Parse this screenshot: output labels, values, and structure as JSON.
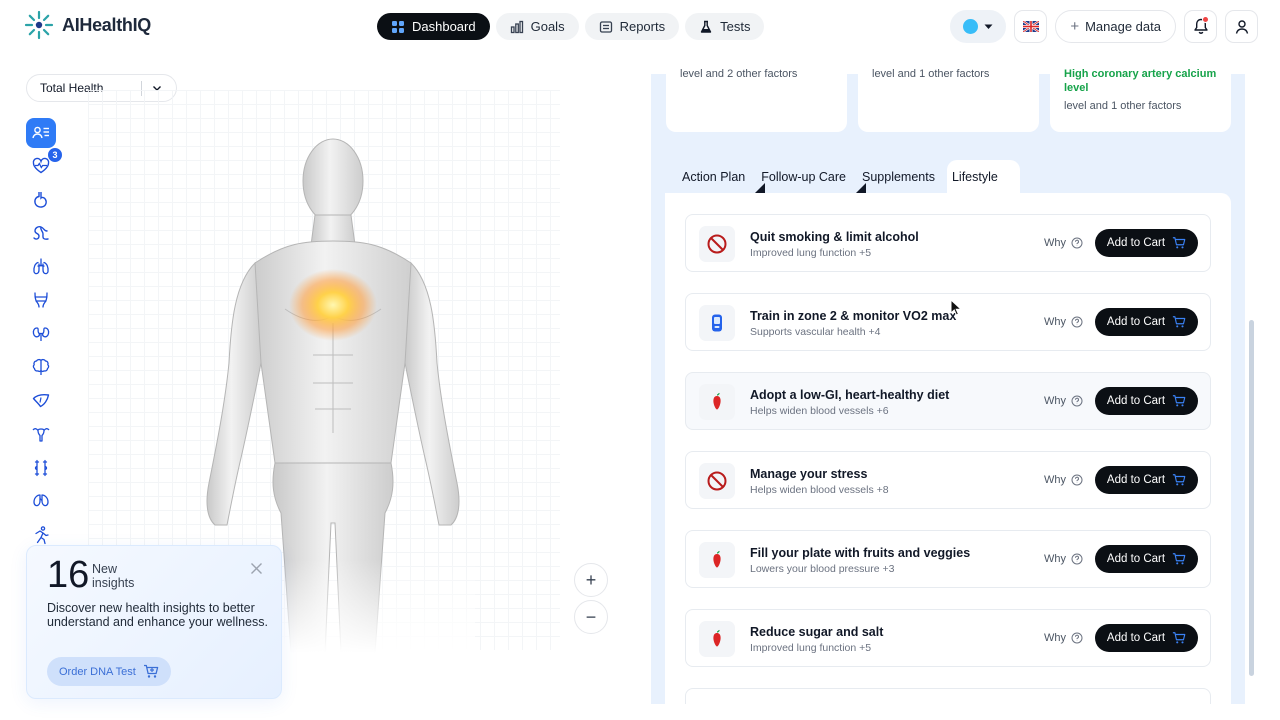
{
  "app": {
    "name": "AIHealthIQ"
  },
  "nav": {
    "tabs": [
      {
        "label": "Dashboard",
        "icon": "grid-icon",
        "active": true
      },
      {
        "label": "Goals",
        "icon": "bar-chart-icon",
        "active": false
      },
      {
        "label": "Reports",
        "icon": "document-icon",
        "active": false
      },
      {
        "label": "Tests",
        "icon": "flask-icon",
        "active": false
      }
    ],
    "manage_data_label": "Manage data",
    "language_flag": "uk-flag-icon"
  },
  "sidebar": {
    "selector_value": "Total Health",
    "organ_icons": [
      "profile-list-icon",
      "heart-icon",
      "stomach-icon",
      "intestine-icon",
      "lungs-icon",
      "bladder-icon",
      "kidneys-icon",
      "brain-icon",
      "liver-icon",
      "uterus-icon",
      "joints-icon",
      "lung-single-icon",
      "runner-icon"
    ],
    "heart_badge": "3"
  },
  "insight": {
    "count": "16",
    "label": "New insights",
    "description": "Discover new health insights to better understand and enhance your wellness.",
    "button_label": "Order DNA Test"
  },
  "zoom": {
    "in_label": "+",
    "out_label": "−"
  },
  "factor_cards": [
    {
      "line_green": "",
      "line_text": "level and 2 other factors"
    },
    {
      "line_green": "",
      "line_text": "level and 1 other factors"
    },
    {
      "line_green": "High coronary artery calcium level",
      "line_text": "level and 1 other factors"
    }
  ],
  "tabs": [
    {
      "label": "Action Plan",
      "active": false
    },
    {
      "label": "Follow-up Care",
      "active": false
    },
    {
      "label": "Supplements",
      "active": false
    },
    {
      "label": "Lifestyle",
      "active": true
    }
  ],
  "recommendations": [
    {
      "icon": "no-sign-icon",
      "title": "Quit smoking & limit alcohol",
      "subtitle": "Improved lung function +5",
      "why": "Why",
      "cta": "Add to Cart",
      "highlighted": false
    },
    {
      "icon": "fitness-tracker-icon",
      "title": "Train in zone 2 & monitor VO2 max",
      "subtitle": "Supports vascular health +4",
      "why": "Why",
      "cta": "Add to Cart",
      "highlighted": false
    },
    {
      "icon": "pepper-icon",
      "title": "Adopt a low-GI, heart-healthy diet",
      "subtitle": "Helps widen blood vessels +6",
      "why": "Why",
      "cta": "Add to Cart",
      "highlighted": true
    },
    {
      "icon": "no-sign-icon",
      "title": "Manage your stress",
      "subtitle": "Helps widen blood vessels +8",
      "why": "Why",
      "cta": "Add to Cart",
      "highlighted": false
    },
    {
      "icon": "pepper-icon",
      "title": "Fill your plate with fruits and veggies",
      "subtitle": "Lowers your blood pressure +3",
      "why": "Why",
      "cta": "Add to Cart",
      "highlighted": false
    },
    {
      "icon": "pepper-icon",
      "title": "Reduce sugar and salt",
      "subtitle": "Improved lung function +5",
      "why": "Why",
      "cta": "Add to Cart",
      "highlighted": false
    }
  ],
  "colors": {
    "accent": "#2f7bf6",
    "dark": "#0b0f14",
    "panel_bg": "#e8f1fd",
    "good": "#16a34a",
    "danger": "#dc2626"
  }
}
